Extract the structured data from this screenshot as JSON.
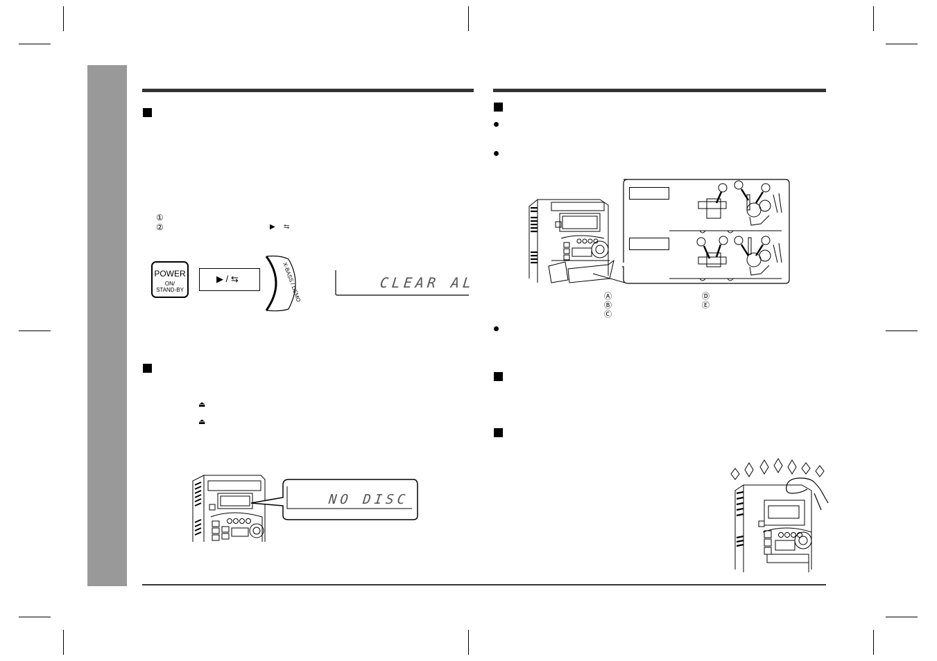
{
  "page": {
    "layout": "two-column manual spread",
    "side_tab_color": "#999999",
    "rule_color": "#333333"
  },
  "left_column": {
    "section1": {
      "bullet": "square",
      "steps": [
        {
          "marker": "①",
          "text": ""
        },
        {
          "marker": "②",
          "text": "",
          "inline_icons": [
            "play-icon",
            "repeat-icon"
          ]
        }
      ],
      "figure": {
        "power_button": {
          "label": "POWER",
          "sublabel_1": "ON/",
          "sublabel_2": "STAND-BY"
        },
        "play_button": {
          "label": "▶ / ⇆"
        },
        "xbass_button": {
          "label": "X-BASS / DEMO"
        },
        "display": {
          "text": "CLEAR AL"
        }
      }
    },
    "section2": {
      "bullet": "square",
      "eject_icons": [
        "⏏",
        "⏏"
      ],
      "figure": {
        "display": {
          "text": "NO DISC"
        }
      }
    }
  },
  "right_column": {
    "section1": {
      "bullet": "square",
      "bullets": [
        "",
        ""
      ],
      "figure": {
        "label_top": "",
        "label_bottom": "",
        "callouts": [
          "Ⓐ",
          "Ⓑ",
          "Ⓒ",
          "Ⓓ",
          "Ⓔ"
        ]
      },
      "legend": [
        {
          "marker": "Ⓐ",
          "text": ""
        },
        {
          "marker": "Ⓑ",
          "text": ""
        },
        {
          "marker": "Ⓒ",
          "text": ""
        },
        {
          "marker": "Ⓓ",
          "text": ""
        },
        {
          "marker": "Ⓔ",
          "text": ""
        }
      ],
      "note_bullet": ""
    },
    "section2": {
      "bullet": "square",
      "text": ""
    },
    "section3": {
      "bullet": "square",
      "text": ""
    }
  }
}
